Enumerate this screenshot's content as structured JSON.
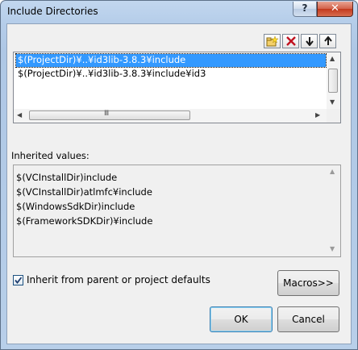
{
  "window": {
    "title": "Include Directories"
  },
  "titlebar": {
    "help_label": "?",
    "close_label": "✕"
  },
  "toolbar": {
    "buttons": [
      {
        "name": "new-line-icon"
      },
      {
        "name": "delete-icon"
      },
      {
        "name": "move-down-icon"
      },
      {
        "name": "move-up-icon"
      }
    ]
  },
  "directories": {
    "items": [
      {
        "text": "$(ProjectDir)¥..¥id3lib-3.8.3¥include",
        "selected": true
      },
      {
        "text": "$(ProjectDir)¥..¥id3lib-3.8.3¥include¥id3",
        "selected": false
      }
    ],
    "hscroll_grip": "Ⅲ"
  },
  "inherited": {
    "label": "Inherited values:",
    "items": [
      "$(VCInstallDir)include",
      "$(VCInstallDir)atlmfc¥include",
      "$(WindowsSdkDir)include",
      "$(FrameworkSDKDir)¥include"
    ]
  },
  "options": {
    "inherit_label": "Inherit from parent or project defaults",
    "inherit_checked": true
  },
  "buttons": {
    "macros": "Macros>>",
    "ok": "OK",
    "cancel": "Cancel"
  },
  "colors": {
    "selection": "#3399ff",
    "close": "#c2391d",
    "frame": "#b5cde9"
  }
}
